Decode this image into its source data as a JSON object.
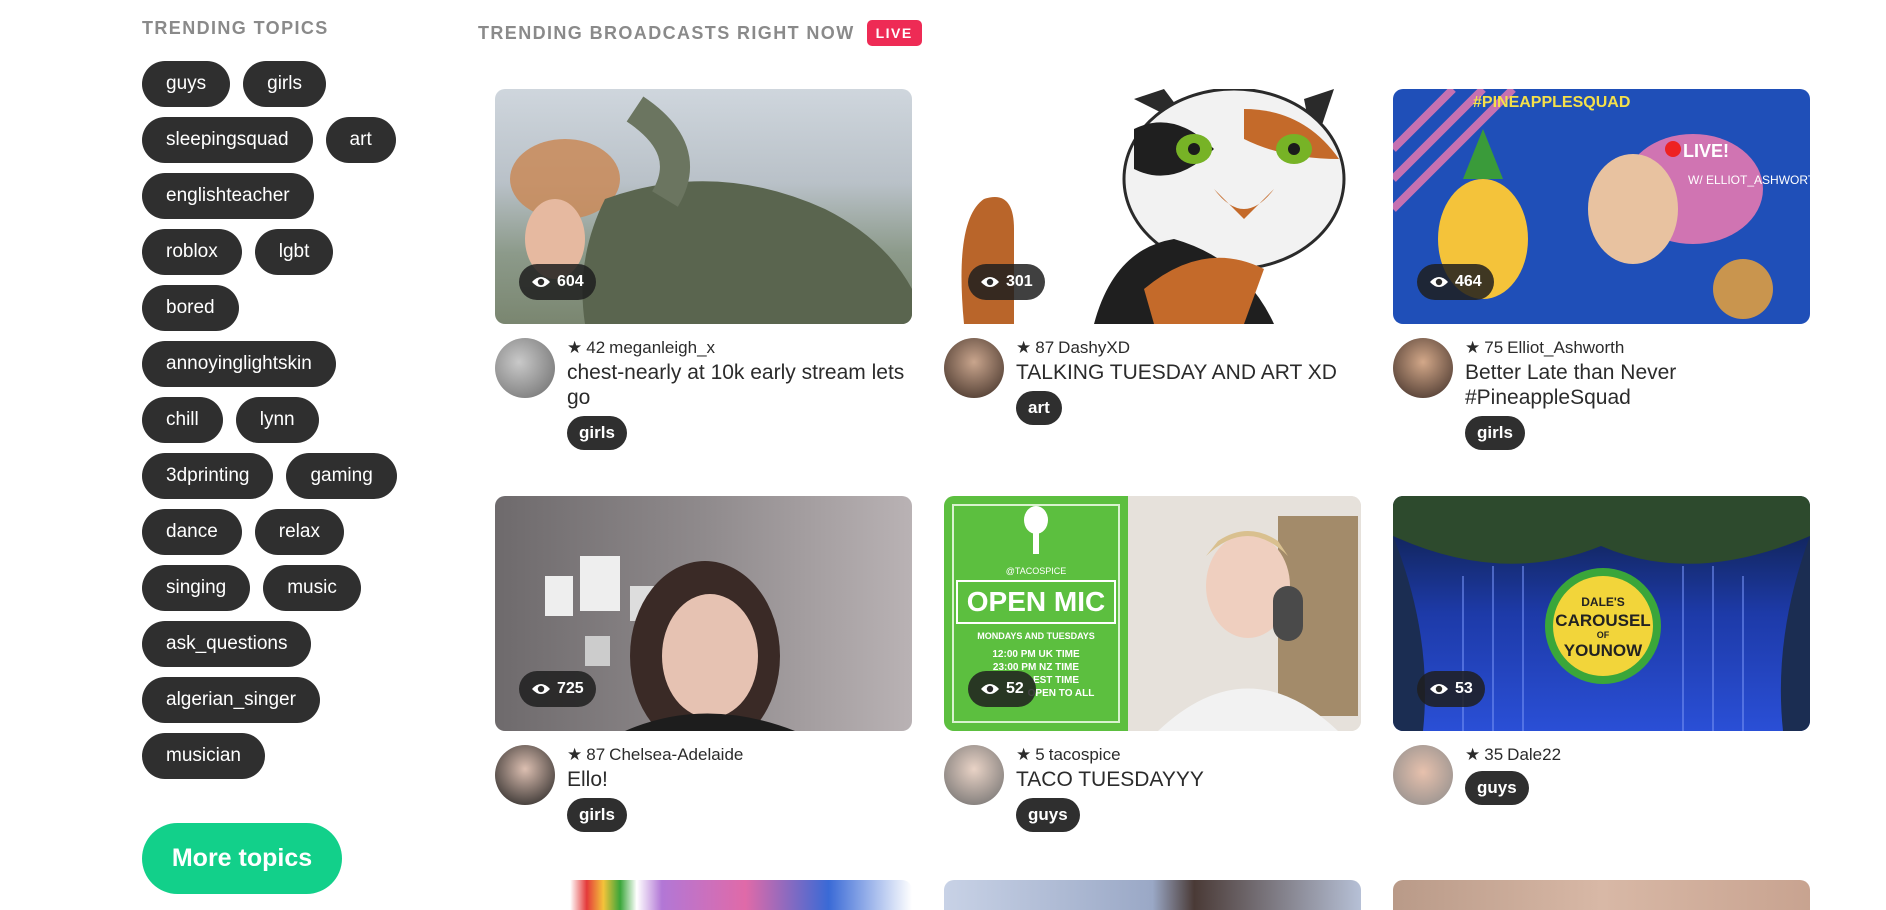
{
  "sidebar": {
    "title": "TRENDING TOPICS",
    "topics": [
      "guys",
      "girls",
      "sleepingsquad",
      "art",
      "englishteacher",
      "roblox",
      "lgbt",
      "bored",
      "annoyinglightskin",
      "chill",
      "lynn",
      "3dprinting",
      "gaming",
      "dance",
      "relax",
      "singing",
      "music",
      "ask_questions",
      "algerian_singer",
      "musician"
    ],
    "more_label": "More topics"
  },
  "main": {
    "title": "TRENDING BROADCASTS RIGHT NOW",
    "live_label": "LIVE",
    "broadcasts": [
      {
        "viewers": "604",
        "level": "42",
        "user": "meganleigh_x",
        "title": "chest-nearly at 10k early stream lets go",
        "tag": "girls"
      },
      {
        "viewers": "301",
        "level": "87",
        "user": "DashyXD",
        "title": "TALKING TUESDAY AND ART XD",
        "tag": "art"
      },
      {
        "viewers": "464",
        "level": "75",
        "user": "Elliot_Ashworth",
        "title": "Better Late than Never #PineappleSquad",
        "tag": "girls"
      },
      {
        "viewers": "725",
        "level": "87",
        "user": "Chelsea-Adelaide",
        "title": "Ello!",
        "tag": "girls"
      },
      {
        "viewers": "52",
        "level": "5",
        "user": "tacospice",
        "title": "TACO TUESDAYYY",
        "tag": "guys"
      },
      {
        "viewers": "53",
        "level": "35",
        "user": "Dale22",
        "title": "",
        "tag": "guys"
      }
    ]
  },
  "thumb_text": {
    "pineapple_hashtag": "#PINEAPPLESQUAD",
    "pineapple_live": "LIVE!",
    "pineapple_with": "W/ ELLIOT_ASHWORTH",
    "openmic_handle": "@TACOSPICE",
    "openmic_title": "OPEN MIC",
    "openmic_days": "MONDAYS AND TUESDAYS",
    "openmic_time1": "12:00 PM UK TIME",
    "openmic_time2": "23:00 PM NZ TIME",
    "openmic_time3": "EST TIME",
    "openmic_open": "OPEN TO ALL",
    "carousel_dales": "DALE'S",
    "carousel_name": "CAROUSEL",
    "carousel_of": "OF",
    "carousel_younow": "YOUNOW"
  },
  "colors": {
    "accent": "#12d08a",
    "live": "#ee2b55",
    "tag_bg": "#2f2f2f"
  }
}
